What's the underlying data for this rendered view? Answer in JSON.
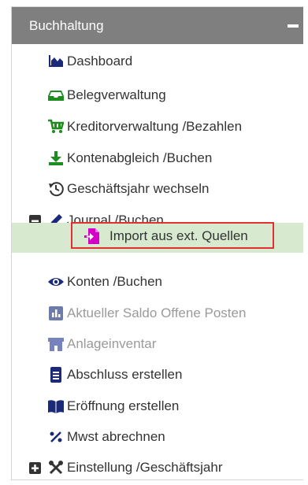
{
  "header": {
    "title": "Buchhaltung"
  },
  "items": {
    "dashboard": "Dashboard",
    "belegverwaltung": "Belegverwaltung",
    "kreditor": "Kreditorverwaltung /Bezahlen",
    "kontenabgleich": "Kontenabgleich /Buchen",
    "geschaeftsjahr_wechseln": "Geschäftsjahr wechseln",
    "journal": "Journal /Buchen",
    "import": "Import aus ext. Quellen",
    "konten": "Konten /Buchen",
    "saldo": "Aktueller Saldo Offene Posten",
    "anlageinventar": "Anlageinventar",
    "abschluss": "Abschluss erstellen",
    "eroeffnung": "Eröffnung erstellen",
    "mwst": "Mwst abrechnen",
    "einstellung": "Einstellung /Geschäftsjahr"
  },
  "colors": {
    "header_bg": "#7f7f7f",
    "icon_navy": "#1a2a78",
    "icon_green": "#1e8c1e",
    "icon_magenta": "#d400c8",
    "selected_bg": "#d7ead0",
    "highlight_border": "#e03030",
    "disabled_text": "#9a9a9a"
  },
  "icons": [
    "area-chart-icon",
    "inbox-icon",
    "shopping-cart-icon",
    "download-icon",
    "history-icon",
    "minus-square-icon",
    "pencil-icon",
    "import-file-icon",
    "eye-icon",
    "bar-chart-icon",
    "store-icon",
    "document-icon",
    "book-icon",
    "percent-icon",
    "plus-square-icon",
    "tools-icon"
  ]
}
